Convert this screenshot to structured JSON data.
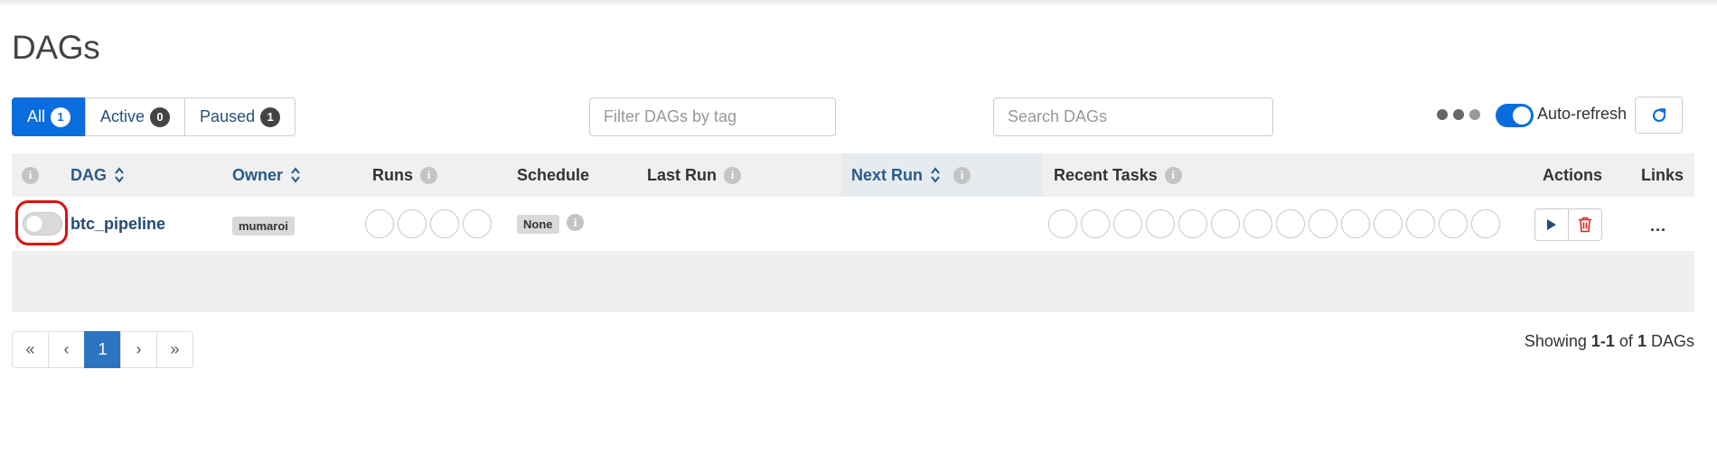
{
  "page": {
    "title": "DAGs"
  },
  "status_filter": {
    "all": {
      "label": "All",
      "count": "1"
    },
    "active": {
      "label": "Active",
      "count": "0"
    },
    "paused": {
      "label": "Paused",
      "count": "1"
    },
    "selected": "All"
  },
  "tag_filter": {
    "placeholder": "Filter DAGs by tag",
    "value": ""
  },
  "search": {
    "placeholder": "Search DAGs",
    "value": ""
  },
  "auto_refresh": {
    "label": "Auto-refresh",
    "enabled": true
  },
  "table": {
    "headers": {
      "dag": "DAG",
      "owner": "Owner",
      "runs": "Runs",
      "schedule": "Schedule",
      "last_run": "Last Run",
      "next_run": "Next Run",
      "recent_tasks": "Recent Tasks",
      "actions": "Actions",
      "links": "Links"
    },
    "rows": [
      {
        "dag_id": "btc_pipeline",
        "owner": "mumaroi",
        "schedule": "None",
        "paused": true,
        "last_run": "",
        "next_run": "",
        "runs_circles": 4,
        "recent_task_circles": 14,
        "links": "..."
      }
    ]
  },
  "pagination": {
    "first": "«",
    "prev": "‹",
    "current": "1",
    "next": "›",
    "last": "»"
  },
  "footer": {
    "showing_prefix": "Showing",
    "range": "1-1",
    "of": "of",
    "total": "1",
    "suffix": "DAGs"
  },
  "colors": {
    "primary": "#0a6dde",
    "link": "#244a78",
    "delete": "#dd2222",
    "annotation": "#dd1111"
  },
  "icons": {
    "refresh": "refresh-icon",
    "trigger": "play-icon",
    "delete": "trash-icon",
    "info": "info-icon",
    "sort": "sort-icon"
  }
}
